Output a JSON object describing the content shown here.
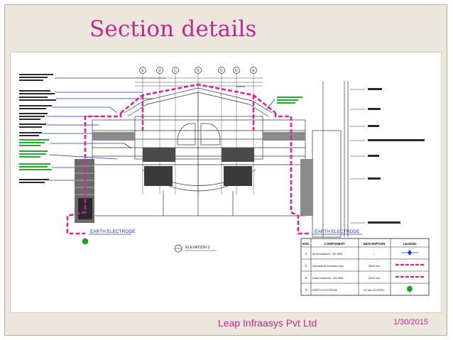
{
  "slide": {
    "title": "Section details",
    "company": "Leap Infraasys Pvt Ltd",
    "date": "1/30/2015"
  },
  "drawing": {
    "grid_labels": [
      "E",
      "D",
      "C",
      "B",
      "C",
      "D",
      "E"
    ],
    "earth_electrode_label": "EARTH ELECTRODE",
    "elevation_label": "ELEVATION 2",
    "colors": {
      "lightning_conductor": "#e0209a",
      "annotation": "#1a33cc",
      "linework": "#333333",
      "earth": "#23a025"
    }
  },
  "legend_table": {
    "headers": [
      "SNO.",
      "COMPONENT",
      "DESCRIPTION",
      "LEGEND"
    ],
    "rows": [
      {
        "sno": "1",
        "component": "Air terminations – BS 6651",
        "description": "–"
      },
      {
        "sno": "2",
        "component": "Horizontal air termination strip",
        "description": "25x3 mm"
      },
      {
        "sno": "3",
        "component": "Down conductor – BS 6651",
        "description": "25x3 mm"
      },
      {
        "sno": "4",
        "component": "EARTH ELECTRODE",
        "description": "50 mm ELPPRC"
      }
    ]
  }
}
